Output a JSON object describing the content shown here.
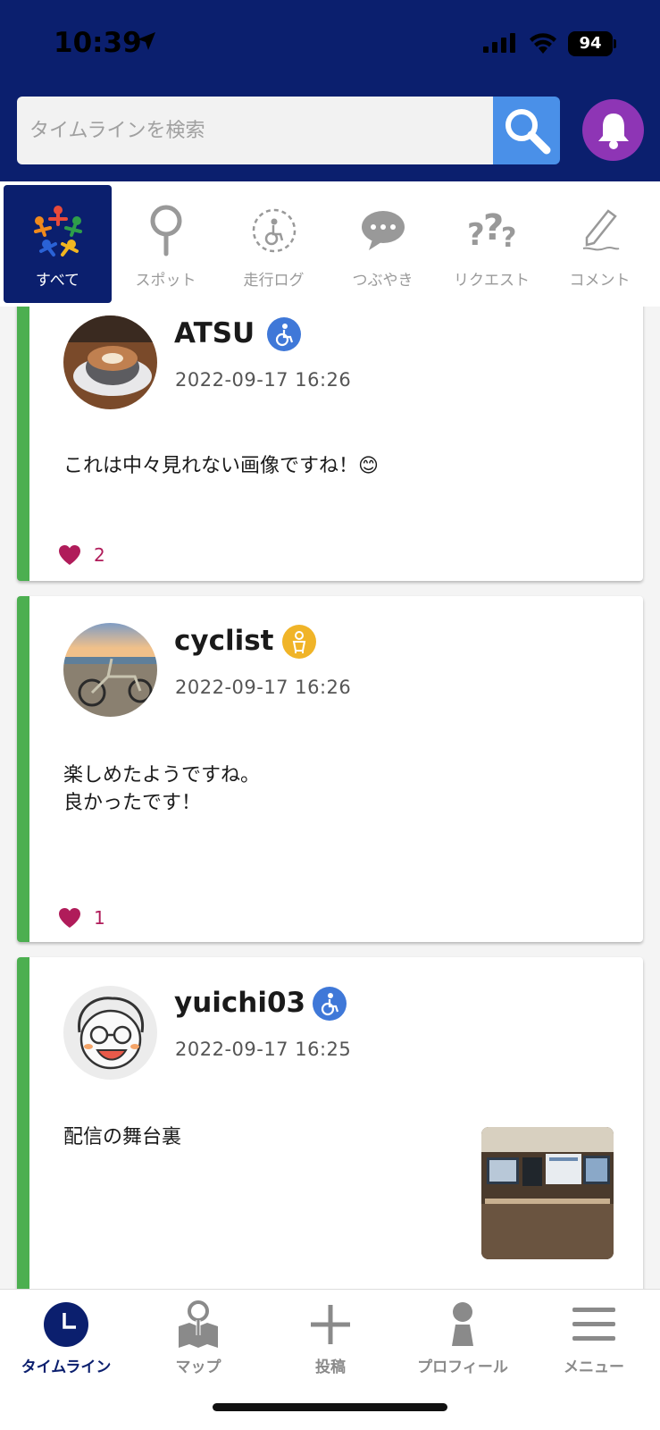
{
  "status_bar": {
    "time": "10:39",
    "battery": "94"
  },
  "search": {
    "placeholder": "タイムラインを検索"
  },
  "colors": {
    "header": "#0b1f6e",
    "search_button": "#4a90e8",
    "bell": "#8e35b5",
    "card_accent": "#4caf50",
    "like": "#b01c5a"
  },
  "tabs": [
    {
      "label": "すべて",
      "icon": "people-circle-icon",
      "active": true
    },
    {
      "label": "スポット",
      "icon": "pin-icon",
      "active": false
    },
    {
      "label": "走行ログ",
      "icon": "wheelchair-route-icon",
      "active": false
    },
    {
      "label": "つぶやき",
      "icon": "speech-bubble-icon",
      "active": false
    },
    {
      "label": "リクエスト",
      "icon": "question-marks-icon",
      "active": false
    },
    {
      "label": "コメント",
      "icon": "pencil-icon",
      "active": false
    }
  ],
  "posts": [
    {
      "username": "ATSU",
      "role_icon": "wheelchair-icon",
      "timestamp": "2022-09-17 16:26",
      "text": "これは中々見れない画像ですね！😊",
      "likes": "2",
      "avatar": "latte-coffee-photo"
    },
    {
      "username": "cyclist",
      "role_icon": "caregiver-icon",
      "timestamp": "2022-09-17 16:26",
      "text": "楽しめたようですね。\n良かったです！",
      "likes": "1",
      "avatar": "beach-bicycle-photo"
    },
    {
      "username": "yuichi03",
      "role_icon": "wheelchair-icon",
      "timestamp": "2022-09-17 16:25",
      "text": "配信の舞台裏",
      "likes": "",
      "avatar": "illustrated-face",
      "thumbnail": "desk-monitors-photo"
    }
  ],
  "bottom_nav": [
    {
      "label": "タイムライン",
      "icon": "clock-icon",
      "active": true
    },
    {
      "label": "マップ",
      "icon": "map-pin-icon",
      "active": false
    },
    {
      "label": "投稿",
      "icon": "plus-icon",
      "active": false
    },
    {
      "label": "プロフィール",
      "icon": "person-icon",
      "active": false
    },
    {
      "label": "メニュー",
      "icon": "hamburger-icon",
      "active": false
    }
  ]
}
